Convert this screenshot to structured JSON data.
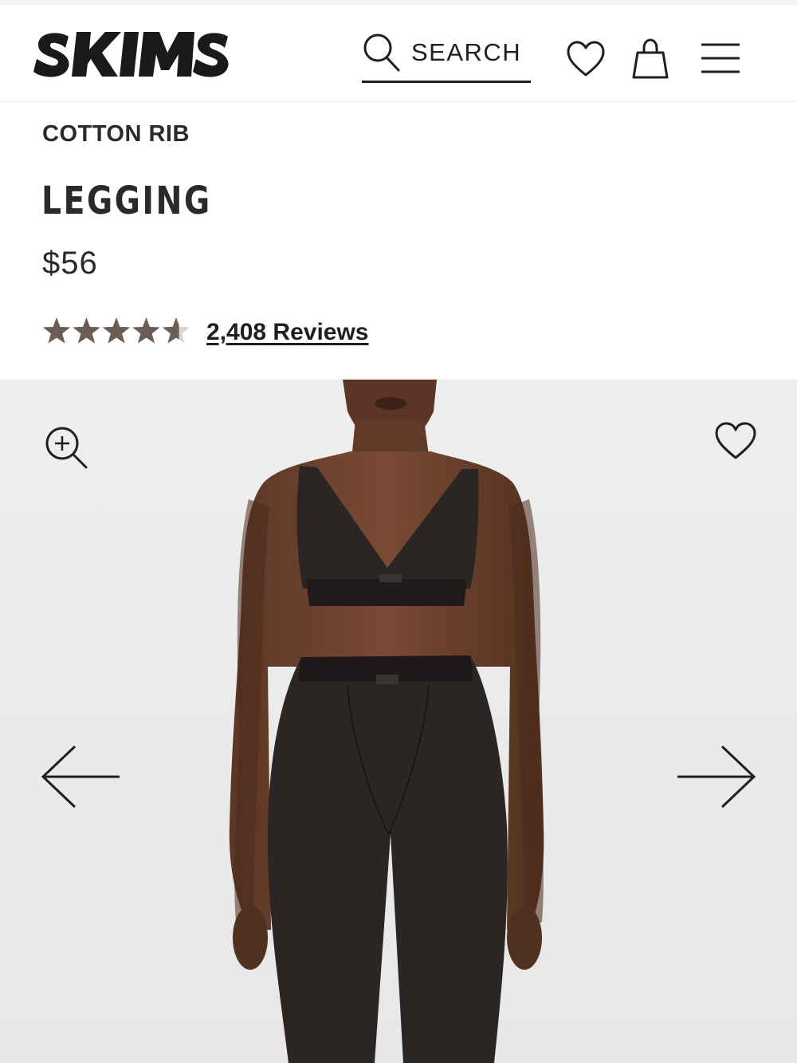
{
  "brand": {
    "logo_text": "SKIMS",
    "logo_icon": "skims-wordmark"
  },
  "header": {
    "search_label": "SEARCH",
    "search_icon": "search-icon",
    "wishlist_icon": "heart-icon",
    "bag_icon": "shopping-bag-icon",
    "menu_icon": "hamburger-menu-icon"
  },
  "product": {
    "collection": "COTTON RIB",
    "title": "LEGGING",
    "price": "$56",
    "rating": {
      "stars_out_of_5": 4.6,
      "star_color": "#6b5d55",
      "reviews_label": "2,408 Reviews"
    }
  },
  "gallery": {
    "zoom_icon": "zoom-in-icon",
    "favorite_icon": "heart-icon",
    "prev_icon": "arrow-left-icon",
    "next_icon": "arrow-right-icon",
    "image_subject": "model wearing black cotton rib bralette and legging",
    "background_color": "#ececec",
    "garment_color": "#2b2624"
  }
}
